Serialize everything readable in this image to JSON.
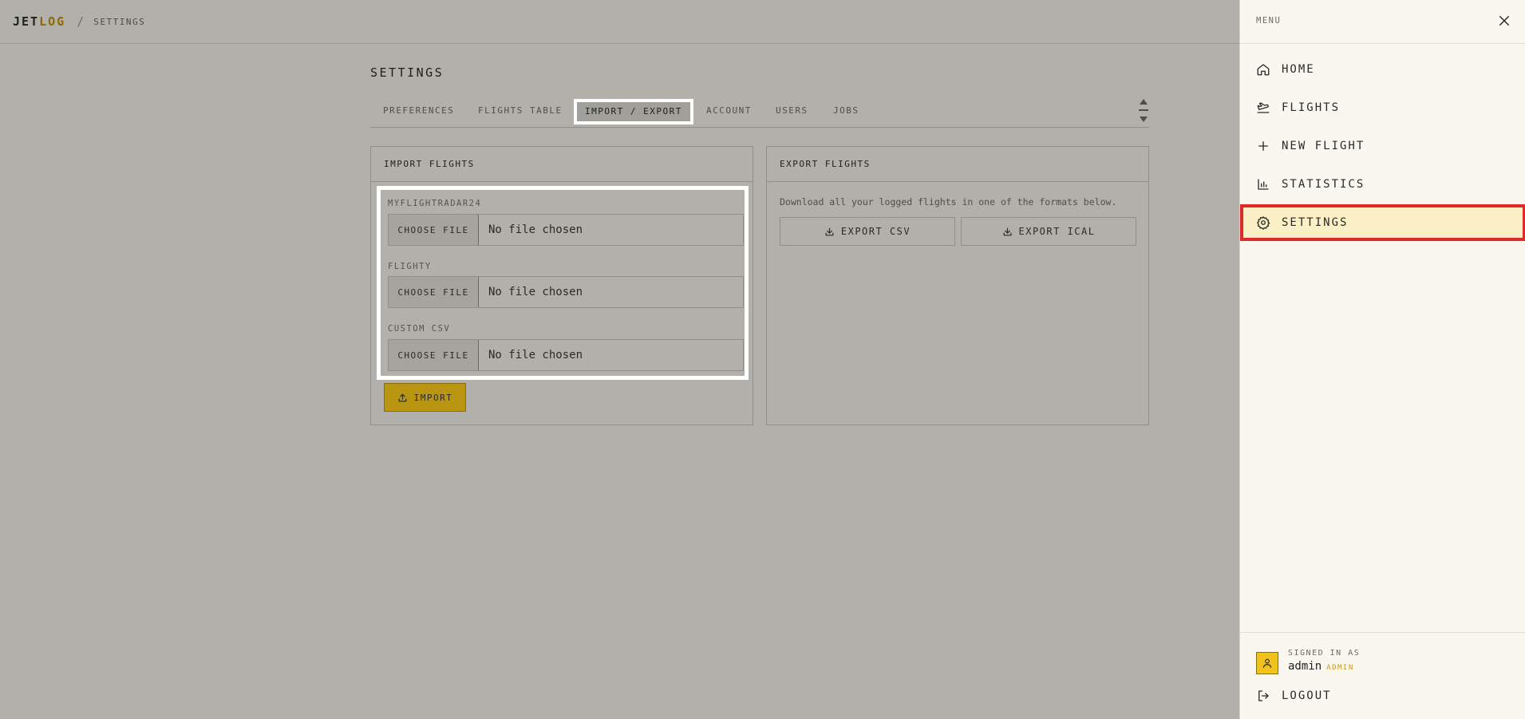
{
  "header": {
    "brand_left": "JET",
    "brand_right": "LOG",
    "separator": "/",
    "breadcrumb": "SETTINGS",
    "accent_color": "#8a6a08"
  },
  "page": {
    "title": "SETTINGS",
    "tabs": [
      {
        "label": "PREFERENCES",
        "active": false
      },
      {
        "label": "FLIGHTS TABLE",
        "active": false
      },
      {
        "label": "IMPORT / EXPORT",
        "active": true
      },
      {
        "label": "ACCOUNT",
        "active": false
      },
      {
        "label": "USERS",
        "active": false
      },
      {
        "label": "JOBS",
        "active": false
      }
    ]
  },
  "import": {
    "title": "IMPORT FLIGHTS",
    "fields": [
      {
        "label": "MYFLIGHTRADAR24",
        "button": "CHOOSE FILE",
        "value": "No file chosen"
      },
      {
        "label": "FLIGHTY",
        "button": "CHOOSE FILE",
        "value": "No file chosen"
      },
      {
        "label": "CUSTOM CSV",
        "button": "CHOOSE FILE",
        "value": "No file chosen"
      }
    ],
    "submit_label": "IMPORT",
    "submit_color": "#b99512"
  },
  "export": {
    "title": "EXPORT FLIGHTS",
    "description": "Download all your logged flights in one of the formats below.",
    "buttons": [
      {
        "label": "EXPORT CSV",
        "icon": "download-icon"
      },
      {
        "label": "EXPORT ICAL",
        "icon": "download-icon"
      }
    ]
  },
  "menu": {
    "title": "MENU",
    "close_icon": "close-icon",
    "items": [
      {
        "label": "HOME",
        "icon": "home-icon",
        "active": false
      },
      {
        "label": "FLIGHTS",
        "icon": "plane-icon",
        "active": false
      },
      {
        "label": "NEW FLIGHT",
        "icon": "plus-icon",
        "active": false
      },
      {
        "label": "STATISTICS",
        "icon": "bar-chart-icon",
        "active": false
      },
      {
        "label": "SETTINGS",
        "icon": "gear-icon",
        "active": true
      }
    ],
    "highlight_color": "#e02a2a",
    "user": {
      "signed_in_label": "SIGNED IN AS",
      "name": "admin",
      "role": "ADMIN",
      "avatar_icon": "user-icon"
    },
    "logout_label": "LOGOUT"
  }
}
